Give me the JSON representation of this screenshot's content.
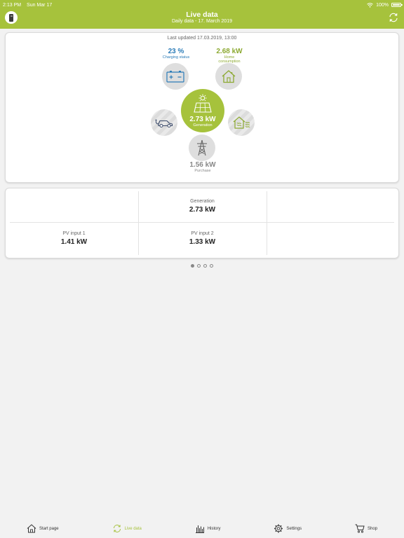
{
  "status_bar": {
    "time": "2:13 PM",
    "date": "Sun Mar 17",
    "battery": "100%"
  },
  "header": {
    "title": "Live data",
    "subtitle": "Daily data - 17. March 2019"
  },
  "flow": {
    "last_updated": "Last updated 17.03.2019, 13:00",
    "battery": {
      "value": "23 %",
      "label": "Charging status"
    },
    "home": {
      "value": "2.68 kW",
      "label_line1": "Home",
      "label_line2": "consumption"
    },
    "generation": {
      "value": "2.73 kW",
      "label": "Generation"
    },
    "grid": {
      "value": "1.56 kW",
      "label": "Purchase"
    }
  },
  "values": {
    "generation": {
      "label": "Generation",
      "value": "2.73 kW"
    },
    "pv1": {
      "label": "PV input 1",
      "value": "1.41 kW"
    },
    "pv2": {
      "label": "PV input 2",
      "value": "1.33 kW"
    }
  },
  "pager": {
    "count": 4,
    "active": 0
  },
  "tabs": [
    {
      "label": "Start page",
      "icon": "house-icon"
    },
    {
      "label": "Live data",
      "icon": "refresh-icon"
    },
    {
      "label": "History",
      "icon": "bar-chart-icon"
    },
    {
      "label": "Settings",
      "icon": "gear-icon"
    },
    {
      "label": "Shop",
      "icon": "cart-icon"
    }
  ],
  "colors": {
    "accent": "#a6c23c",
    "battery_blue": "#2b7cb8",
    "home_green": "#8ca931"
  }
}
